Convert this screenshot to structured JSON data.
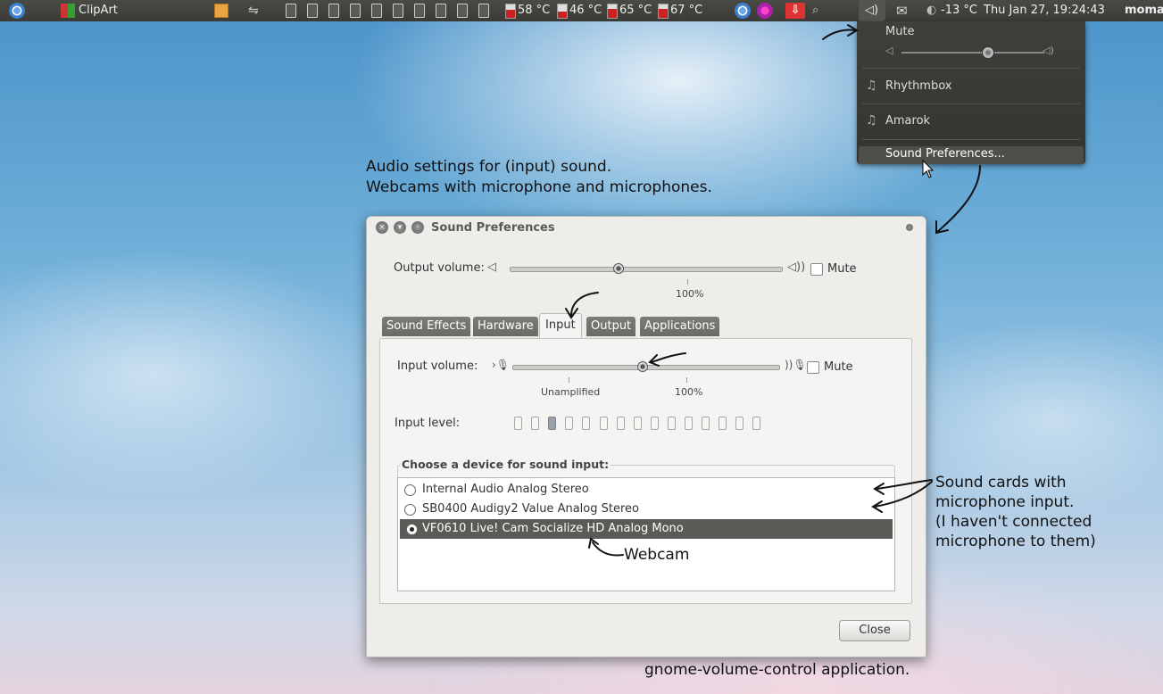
{
  "panel": {
    "app_label": "ClipArt",
    "temps": [
      "58 °C",
      "46 °C",
      "65 °C",
      "67 °C"
    ],
    "weather": "-13 °C",
    "datetime": "Thu Jan 27, 19:24:43",
    "user": "moma"
  },
  "sound_menu": {
    "mute_label": "Mute",
    "volume_level": 0.6,
    "players": [
      "Rhythmbox",
      "Amarok"
    ],
    "preferences_label": "Sound Preferences..."
  },
  "annotations": {
    "top_line1": "Audio settings for (input) sound.",
    "top_line2": "Webcams with microphone and microphones.",
    "webcam": "Webcam",
    "sound_cards": [
      "Sound cards with",
      "microphone input.",
      "(I haven't connected",
      "microphone to them)"
    ],
    "bottom": "gnome-volume-control application."
  },
  "window": {
    "title": "Sound Preferences",
    "output_volume_label": "Output volume:",
    "output_volume_value": 0.4,
    "output_mark_100": "100%",
    "mute_label": "Mute",
    "tabs": [
      "Sound Effects",
      "Hardware",
      "Input",
      "Output",
      "Applications"
    ],
    "active_tab": "Input",
    "input_volume_label": "Input volume:",
    "input_volume_value": 0.49,
    "input_mark_unamplified": "Unamplified",
    "input_mark_100": "100%",
    "input_level_label": "Input level:",
    "input_level_segments": 15,
    "input_level_lit": 3,
    "device_frame_label": "Choose a device for sound input:",
    "devices": [
      {
        "name": "Internal Audio Analog Stereo",
        "selected": false
      },
      {
        "name": "SB0400 Audigy2 Value Analog Stereo",
        "selected": false
      },
      {
        "name": "VF0610 Live! Cam Socialize HD Analog Mono",
        "selected": true
      }
    ],
    "close_label": "Close"
  },
  "colors": {
    "panel_bg": "#3c3b37",
    "menu_bg": "#3a3a35",
    "selection": "#5c5a57"
  }
}
